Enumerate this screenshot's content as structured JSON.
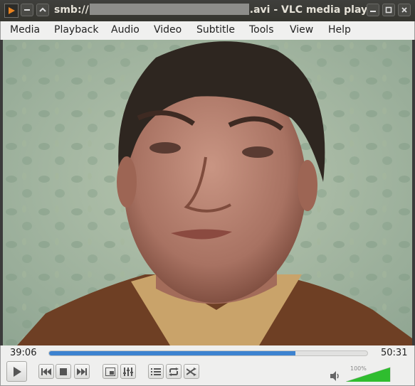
{
  "window": {
    "title_prefix": "smb://",
    "title_suffix": ".avi - VLC media player"
  },
  "menu": {
    "items": [
      "Media",
      "Playback",
      "Audio",
      "Video",
      "Subtitle",
      "Tools",
      "View",
      "Help"
    ]
  },
  "player": {
    "elapsed": "39:06",
    "duration": "50:31",
    "progress_fraction": 0.774,
    "volume_label": "100%",
    "volume_fraction": 1.0
  },
  "colors": {
    "seek_fill": "#3d83d0",
    "volume_fill": "#2fbd2f"
  },
  "icons": {
    "app": "vlc-icon",
    "play": "play-icon",
    "previous": "previous-icon",
    "stop": "stop-icon",
    "next": "next-icon",
    "fullscreen": "fullscreen-icon",
    "extended": "equalizer-icon",
    "playlist": "playlist-icon",
    "loop": "loop-icon",
    "random": "shuffle-icon",
    "speaker": "speaker-icon"
  }
}
